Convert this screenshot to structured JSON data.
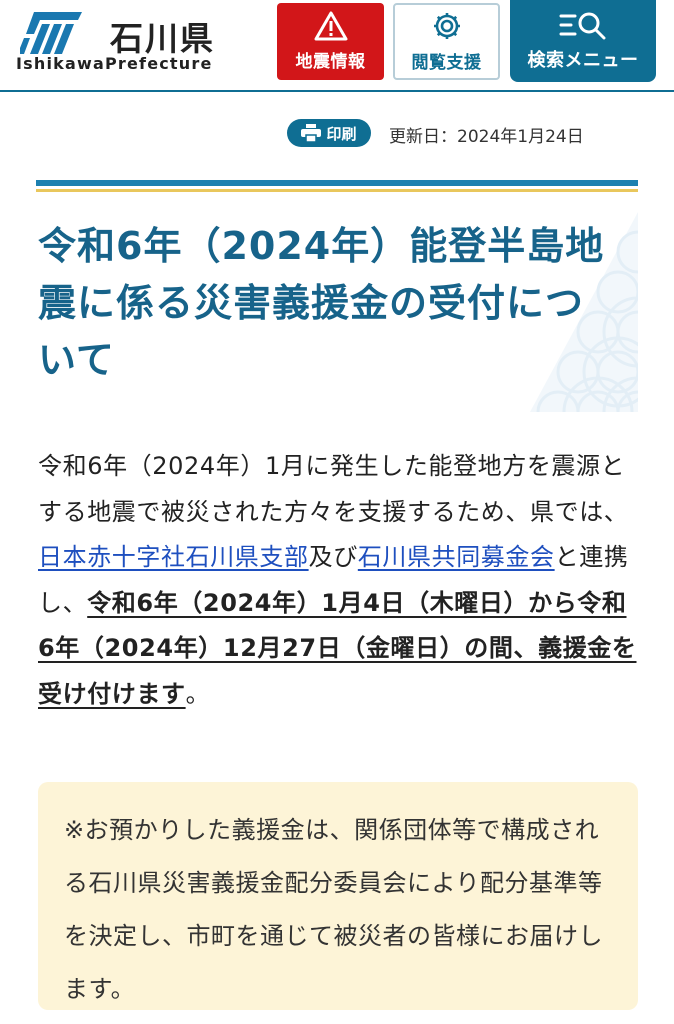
{
  "header": {
    "logo_jp": "石川県",
    "logo_en": "IshikawaPrefecture",
    "buttons": {
      "earthquake": "地震情報",
      "accessibility": "閲覧支援",
      "search_menu": "検索メニュー"
    }
  },
  "utility": {
    "print_label": "印刷",
    "updated": "更新日：2024年1月24日"
  },
  "article": {
    "title": "令和6年（2024年）能登半島地震に係る災害義援金の受付について",
    "body": {
      "part1": "令和6年（2024年）1月に発生した能登地方を震源とする地震で被災された方々を支援するため、県では、",
      "link1": "日本赤十字社石川県支部",
      "part2": "及び",
      "link2": "石川県共同募金会",
      "part3": "と連携し、",
      "emphasis": "令和6年（2024年）1月4日（木曜日）から令和6年（2024年）12月27日（金曜日）の間、義援金を受け付けます",
      "part4": "。"
    },
    "notice": "※お預かりした義援金は、関係団体等で構成される石川県災害義援金配分委員会により配分基準等を決定し、市町を通じて被災者の皆様にお届けします。"
  },
  "colors": {
    "brand": "#0f6e93",
    "title": "#17638a",
    "alert": "#d21619",
    "link": "#1e4fbf",
    "notice_bg": "#fdf4d7",
    "accent_rule": "#e9c75c"
  },
  "icons": {
    "earthquake": "warning-triangle-icon",
    "accessibility": "gear-icon",
    "search_menu": "menu-search-icon",
    "print": "printer-icon"
  }
}
